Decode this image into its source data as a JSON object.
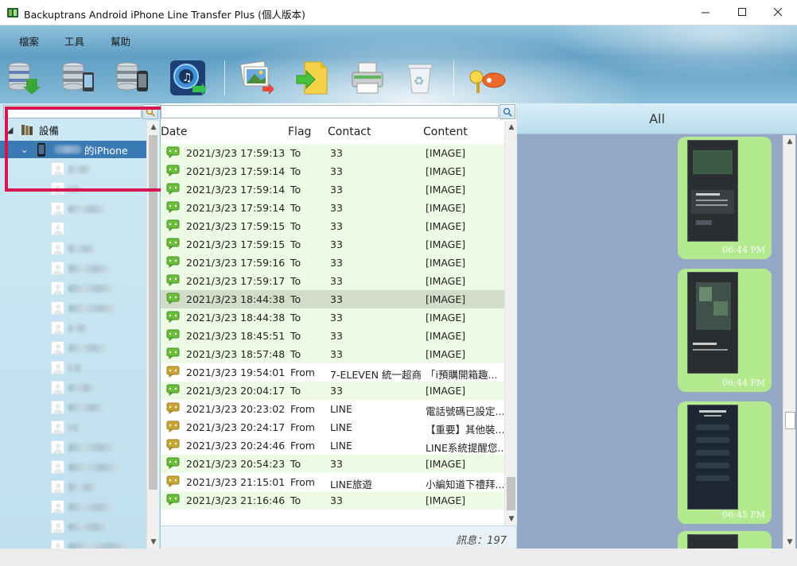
{
  "window": {
    "title": "Backuptrans Android iPhone Line Transfer Plus (個人版本)",
    "controls": [
      "minimize",
      "maximize",
      "close"
    ]
  },
  "menu": {
    "items": [
      {
        "label": "檔案"
      },
      {
        "label": "工具"
      },
      {
        "label": "幫助"
      }
    ]
  },
  "toolbar": {
    "buttons": [
      {
        "icon": "backup-database-icon"
      },
      {
        "icon": "restore-to-android-icon"
      },
      {
        "icon": "transfer-to-iphone-icon"
      },
      {
        "icon": "itunes-transfer-icon"
      },
      {
        "icon": "export-photos-icon"
      },
      {
        "icon": "export-document-icon"
      },
      {
        "icon": "print-icon"
      },
      {
        "icon": "recycle-bin-icon"
      },
      {
        "icon": "license-key-icon"
      }
    ]
  },
  "tree": {
    "root_label": "設備",
    "device_label": "的iPhone",
    "contact_count_visible": 20
  },
  "list": {
    "columns": {
      "date": "Date",
      "flag": "Flag",
      "contact": "Contact",
      "content": "Content"
    },
    "rows": [
      {
        "date": "2021/3/23 17:59:13",
        "flag": "To",
        "contact": "33",
        "content": "[IMAGE]",
        "icon": "green"
      },
      {
        "date": "2021/3/23 17:59:14",
        "flag": "To",
        "contact": "33",
        "content": "[IMAGE]",
        "icon": "green"
      },
      {
        "date": "2021/3/23 17:59:14",
        "flag": "To",
        "contact": "33",
        "content": "[IMAGE]",
        "icon": "green"
      },
      {
        "date": "2021/3/23 17:59:14",
        "flag": "To",
        "contact": "33",
        "content": "[IMAGE]",
        "icon": "green"
      },
      {
        "date": "2021/3/23 17:59:15",
        "flag": "To",
        "contact": "33",
        "content": "[IMAGE]",
        "icon": "green"
      },
      {
        "date": "2021/3/23 17:59:15",
        "flag": "To",
        "contact": "33",
        "content": "[IMAGE]",
        "icon": "green"
      },
      {
        "date": "2021/3/23 17:59:16",
        "flag": "To",
        "contact": "33",
        "content": "[IMAGE]",
        "icon": "green"
      },
      {
        "date": "2021/3/23 17:59:17",
        "flag": "To",
        "contact": "33",
        "content": "[IMAGE]",
        "icon": "green"
      },
      {
        "date": "2021/3/23 18:44:38",
        "flag": "To",
        "contact": "33",
        "content": "[IMAGE]",
        "icon": "green",
        "selected": true
      },
      {
        "date": "2021/3/23 18:44:38",
        "flag": "To",
        "contact": "33",
        "content": "[IMAGE]",
        "icon": "green"
      },
      {
        "date": "2021/3/23 18:45:51",
        "flag": "To",
        "contact": "33",
        "content": "[IMAGE]",
        "icon": "green"
      },
      {
        "date": "2021/3/23 18:57:48",
        "flag": "To",
        "contact": "33",
        "content": "[IMAGE]",
        "icon": "green"
      },
      {
        "date": "2021/3/23 19:54:01",
        "flag": "From",
        "contact": "7-ELEVEN 統一超商",
        "content": "「i預購開箱趣...",
        "icon": "yellow"
      },
      {
        "date": "2021/3/23 20:04:17",
        "flag": "To",
        "contact": "33",
        "content": "[IMAGE]",
        "icon": "green"
      },
      {
        "date": "2021/3/23 20:23:02",
        "flag": "From",
        "contact": "LINE",
        "content": "電話號碼已設定...",
        "icon": "yellow"
      },
      {
        "date": "2021/3/23 20:24:17",
        "flag": "From",
        "contact": "LINE",
        "content": "【重要】其他裝...",
        "icon": "yellow"
      },
      {
        "date": "2021/3/23 20:24:46",
        "flag": "From",
        "contact": "LINE",
        "content": "LINE系統提醒您...",
        "icon": "yellow"
      },
      {
        "date": "2021/3/23 20:54:23",
        "flag": "To",
        "contact": "33",
        "content": "[IMAGE]",
        "icon": "green"
      },
      {
        "date": "2021/3/23 21:15:01",
        "flag": "From",
        "contact": "LINE旅遊",
        "content": "小編知道下禮拜...",
        "icon": "yellow"
      },
      {
        "date": "2021/3/23 21:16:46",
        "flag": "To",
        "contact": "33",
        "content": "[IMAGE]",
        "icon": "green"
      }
    ],
    "status": "訊息：197"
  },
  "preview": {
    "title": "All",
    "bubbles": [
      {
        "time": "06:44 PM"
      },
      {
        "time": "06:44 PM"
      },
      {
        "time": "06:45 PM"
      }
    ]
  },
  "colors": {
    "highlight_box": "#d6174f",
    "selected_tree": "#3b7bb5",
    "to_row_bg": "#eefbe4",
    "bubble": "#b3e98f",
    "preview_bg": "#95a9c6"
  }
}
